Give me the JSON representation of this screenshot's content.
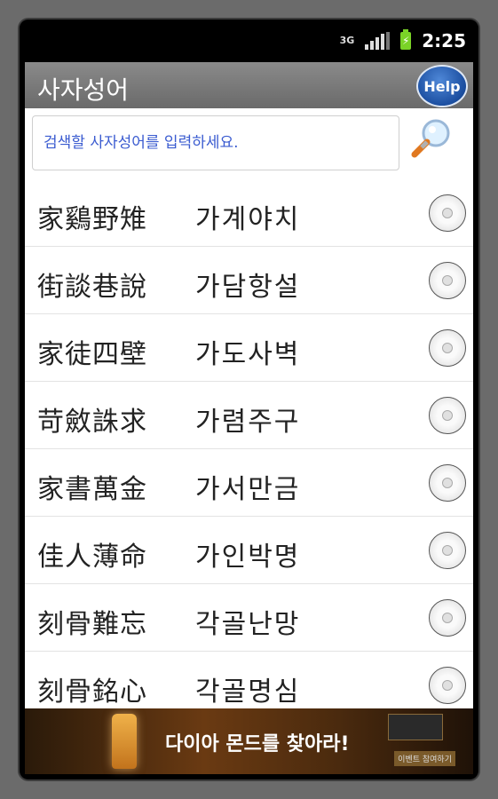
{
  "status_bar": {
    "network": "3G",
    "time": "2:25"
  },
  "app_bar": {
    "title": "사자성어",
    "help_label": "Help"
  },
  "search": {
    "placeholder": "검색할 사자성어를 입력하세요."
  },
  "idioms": [
    {
      "hanja": "家鷄野雉",
      "hangul": "가계야치"
    },
    {
      "hanja": "街談巷說",
      "hangul": "가담항설"
    },
    {
      "hanja": "家徒四壁",
      "hangul": "가도사벽"
    },
    {
      "hanja": "苛斂誅求",
      "hangul": "가렴주구"
    },
    {
      "hanja": "家書萬金",
      "hangul": "가서만금"
    },
    {
      "hanja": "佳人薄命",
      "hangul": "가인박명"
    },
    {
      "hanja": "刻骨難忘",
      "hangul": "각골난망"
    },
    {
      "hanja": "刻骨銘心",
      "hangul": "각골명심"
    }
  ],
  "ad": {
    "headline": "다이아 몬드를 찾아라!",
    "sub_label": "이벤트 참여하기"
  },
  "colors": {
    "placeholder_text": "#3a5bd0",
    "app_bar": "#7a7a7a",
    "help_button": "#1b4ea0"
  }
}
